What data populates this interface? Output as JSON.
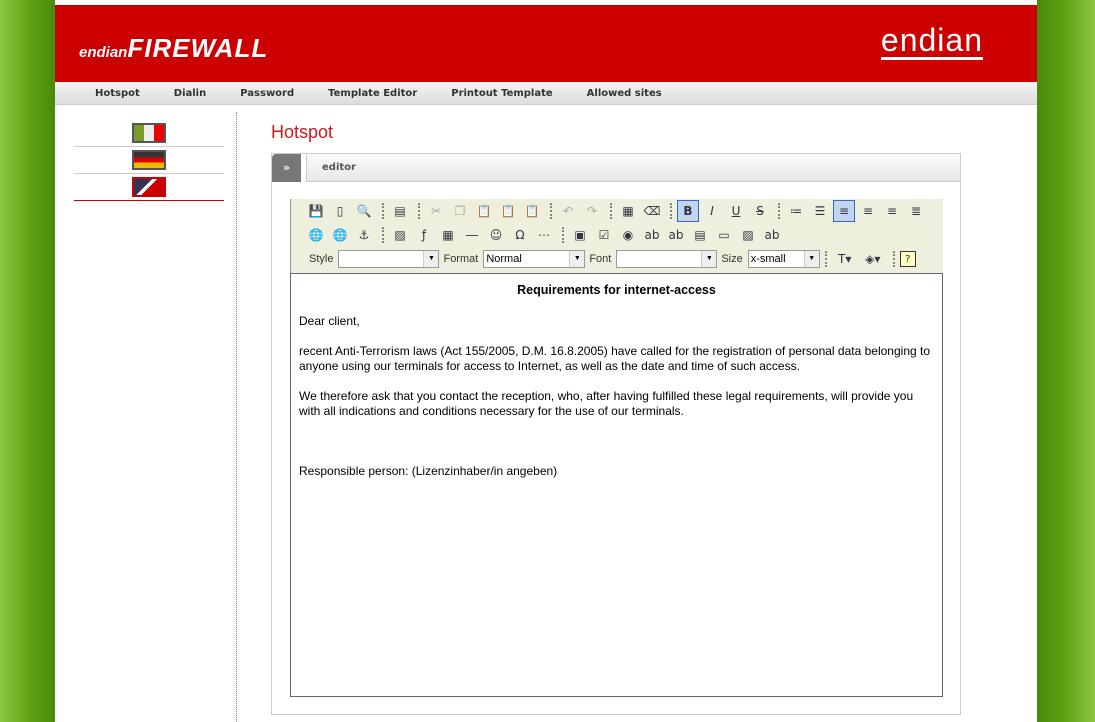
{
  "header": {
    "logo_small": "endian",
    "logo_big": "FIREWALL",
    "brand": "endian"
  },
  "nav": [
    "Hotspot",
    "Dialin",
    "Password",
    "Template Editor",
    "Printout Template",
    "Allowed sites"
  ],
  "languages": [
    {
      "name": "italian",
      "colors": [
        "#7c9a2a",
        "#eee",
        "#e00"
      ]
    },
    {
      "name": "german",
      "colors": [
        "#333",
        "#d00",
        "#eebb00"
      ]
    },
    {
      "name": "english",
      "colors": [
        "#335",
        "#c00",
        "#fff"
      ]
    }
  ],
  "page_title": "Hotspot",
  "panel": {
    "toggle": "»",
    "tab": "editor"
  },
  "toolbar": {
    "row1": [
      "save-icon",
      "new-document-icon",
      "preview-icon",
      "sep",
      "template-icon",
      "sep",
      "cut-icon",
      "copy-icon",
      "paste-icon",
      "paste-text-icon",
      "paste-word-icon",
      "sep",
      "undo-icon",
      "redo-icon",
      "sep",
      "select-all-icon",
      "remove-format-icon",
      "sep",
      "bold-icon",
      "italic-icon",
      "underline-icon",
      "strikethrough-icon",
      "sep",
      "ordered-list-icon",
      "unordered-list-icon",
      "align-left-icon",
      "align-center-icon",
      "align-right-icon",
      "justify-icon"
    ],
    "row2": [
      "link-icon",
      "unlink-icon",
      "anchor-icon",
      "sep",
      "image-icon",
      "flash-icon",
      "table-icon",
      "horizontal-rule-icon",
      "smiley-icon",
      "special-char-icon",
      "page-break-icon",
      "sep",
      "form-icon",
      "checkbox-icon",
      "radio-icon",
      "text-field-icon",
      "textarea-icon",
      "select-field-icon",
      "button-icon",
      "image-button-icon",
      "hidden-field-icon"
    ],
    "style_label": "Style",
    "style_value": "",
    "format_label": "Format",
    "format_value": "Normal",
    "font_label": "Font",
    "font_value": "",
    "size_label": "Size",
    "size_value": "x-small"
  },
  "editor": {
    "heading": "Requirements for internet-access",
    "paragraphs": [
      "Dear client,",
      "recent Anti-Terrorism laws (Act 155/2005, D.M. 16.8.2005) have called for the registration of personal data belonging to anyone using our terminals for access to Internet, as well as the date and time of such access.",
      "We therefore ask that you contact the reception, who, after having fulfilled these legal requirements, will provide you with all indications and conditions necessary for the use of our terminals."
    ],
    "footer": "Responsible person: (Lizenzinhaber/in angeben)"
  }
}
